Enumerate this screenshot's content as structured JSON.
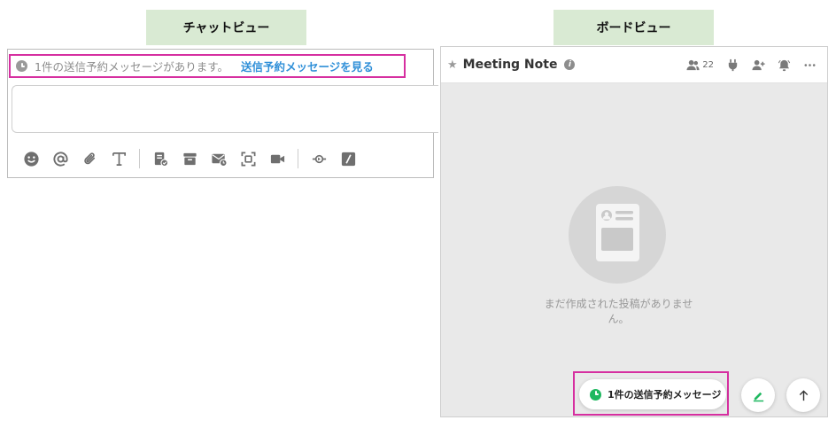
{
  "labels": {
    "chat_view": "チャットビュー",
    "board_view": "ボードビュー"
  },
  "chat": {
    "notice_text": "1件の送信予約メッセージがあります。",
    "notice_link": "送信予約メッセージを見る",
    "input_value": "",
    "toolbar_icons": [
      "emoji-icon",
      "mention-icon",
      "attach-icon",
      "text-format-icon",
      "task-icon",
      "archive-icon",
      "mail-schedule-icon",
      "screen-capture-icon",
      "video-icon",
      "integration-icon",
      "slash-command-icon"
    ]
  },
  "board": {
    "title": "Meeting Note",
    "member_count": "22",
    "empty_message": "まだ作成された投稿がありません。",
    "scheduled_button": "1件の送信予約メッセージ"
  },
  "colors": {
    "highlight": "#d62fa0",
    "link": "#2f8fd8",
    "green": "#1fb860",
    "label_bg": "#d9ead3"
  }
}
